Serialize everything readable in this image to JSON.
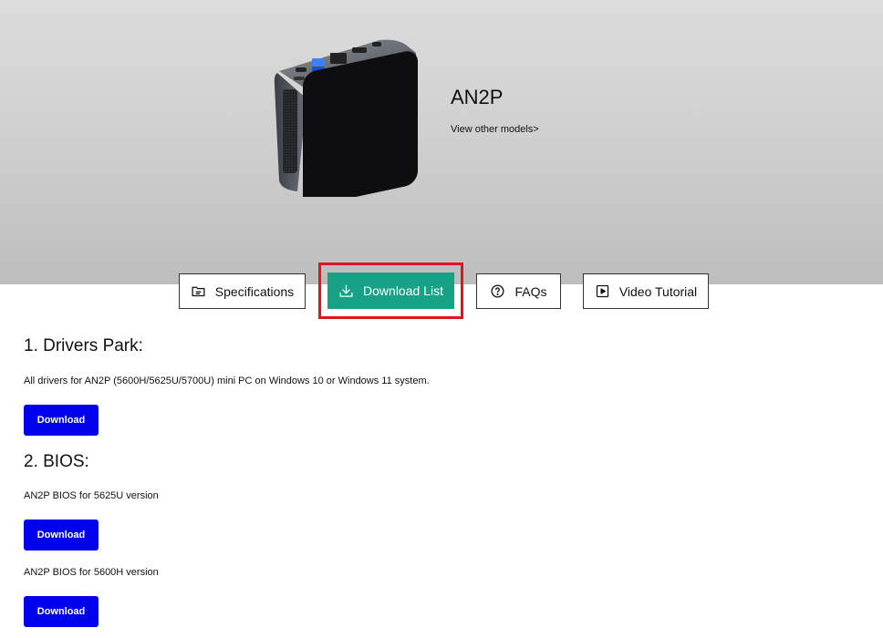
{
  "product": {
    "name": "AN2P",
    "other_models_link": "View other models>"
  },
  "tabs": [
    {
      "label": "Specifications",
      "icon": "folder-icon"
    },
    {
      "label": "Download List",
      "icon": "download-icon"
    },
    {
      "label": "FAQs",
      "icon": "question-circle-icon"
    },
    {
      "label": "Video Tutorial",
      "icon": "play-icon"
    }
  ],
  "sections": {
    "drivers": {
      "title": "1. Drivers Park:",
      "description": "All drivers for AN2P (5600H/5625U/5700U) mini PC on Windows 10 or Windows 11 system.",
      "button": "Download"
    },
    "bios": {
      "title": "2. BIOS:",
      "items": [
        {
          "description": "AN2P BIOS for 5625U version",
          "button": "Download"
        },
        {
          "description": "AN2P BIOS for 5600H version",
          "button": "Download"
        }
      ]
    }
  },
  "colors": {
    "accent_green": "#17a286",
    "highlight_red": "#e0161d",
    "download_blue": "#0000ee"
  }
}
